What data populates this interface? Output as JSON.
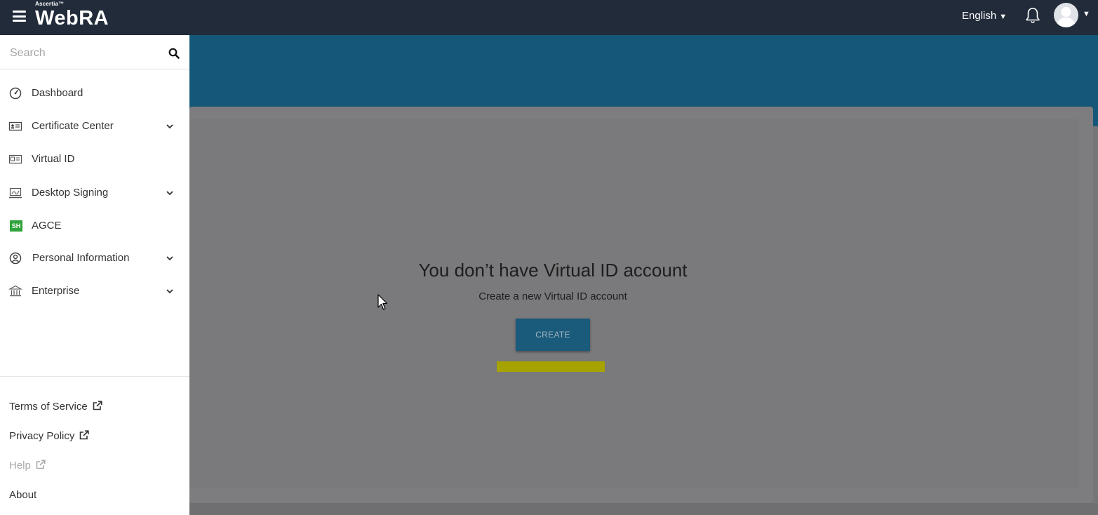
{
  "header": {
    "logo_small": "Ascertia™",
    "logo_main": "WebRA",
    "language": "English"
  },
  "sidebar": {
    "search_placeholder": "Search",
    "items": [
      {
        "label": "Dashboard",
        "icon": "dashboard-icon",
        "expandable": false
      },
      {
        "label": "Certificate Center",
        "icon": "certificate-icon",
        "expandable": true
      },
      {
        "label": "Virtual ID",
        "icon": "id-card-icon",
        "expandable": false
      },
      {
        "label": "Desktop Signing",
        "icon": "desktop-signing-icon",
        "expandable": true
      },
      {
        "label": "AGCE",
        "icon": "agce-icon",
        "expandable": false
      },
      {
        "label": "Personal Information",
        "icon": "user-circle-icon",
        "expandable": true
      },
      {
        "label": "Enterprise",
        "icon": "bank-icon",
        "expandable": true
      }
    ],
    "agce_icon_text": "SH",
    "footer": {
      "terms": "Terms of Service",
      "privacy": "Privacy Policy",
      "help": "Help",
      "about": "About"
    }
  },
  "main": {
    "empty_title": "You don’t have Virtual ID account",
    "empty_subtitle": "Create a new Virtual ID account",
    "create_button": "CREATE"
  },
  "colors": {
    "topbar": "#222b3a",
    "band": "#155778",
    "overlay_gray": "#767577",
    "agce_green": "#2fa33b",
    "highlight": "#a6a200"
  }
}
